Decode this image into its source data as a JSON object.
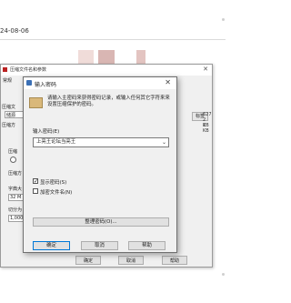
{
  "screen": {
    "date": "24-08-06"
  },
  "parent_window": {
    "title": "压缩文件名和参数",
    "tab_general": "常规",
    "labels": [
      "压缩文",
      "压缩方",
      "压缩",
      "压缩方",
      "字典大",
      "切分为"
    ],
    "values": [
      "储源",
      "32 M",
      "1,000"
    ],
    "right_texts": [
      "627",
      "2 KB",
      "2 KB"
    ],
    "right_button": "标签",
    "buttons": {
      "ok": "确定",
      "cancel": "取消",
      "help": "帮助"
    }
  },
  "password_dialog": {
    "title": "输入密码",
    "description": "请输入主密码来获得密码记录，或输入任何其它字符来来设置压缩保护的密码。",
    "password_label": "输入密码(E)",
    "password_value": "上亮王论坛当亮王",
    "show_password_label": "显示密码(S)",
    "show_password_checked": true,
    "encrypt_names_label": "加密文件名(N)",
    "encrypt_names_checked": false,
    "organize_button": "整理密码(O)...",
    "buttons": {
      "ok": "确定",
      "cancel": "取消",
      "help": "帮助"
    }
  },
  "colors": {
    "accent": "#0078d7",
    "title_bg": "#ffffff",
    "dialog_bg": "#f0f0f0"
  }
}
